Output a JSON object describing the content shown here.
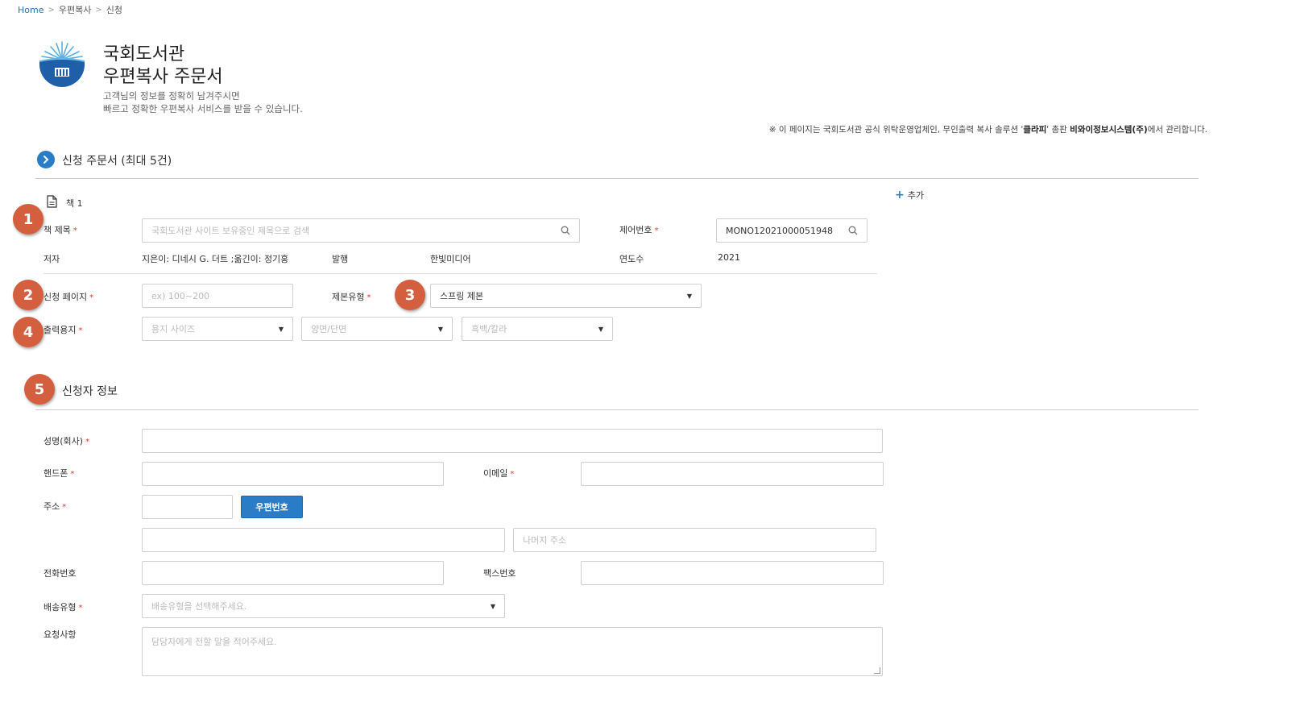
{
  "breadcrumb": {
    "home": "Home",
    "level1": "우편복사",
    "level2": "신청",
    "sep": ">"
  },
  "header": {
    "library_name": "국회도서관",
    "form_title": "우편복사 주문서",
    "desc_line1": "고객님의 정보를 정확히 남겨주시면",
    "desc_line2": "빠르고 정확한 우편복사 서비스를 받을 수 있습니다.",
    "notice_pre": "※ 이 페이지는 국회도서관 공식 위탁운영업체인, 무인출력 복사 솔루션 '",
    "notice_brand": "클라피",
    "notice_mid": "' 총판 ",
    "notice_company": "비와이정보시스템(주)",
    "notice_post": "에서 관리합니다."
  },
  "order_section": {
    "title": "신청 주문서 (최대 5건)",
    "add_label": "추가",
    "add_plus": "+",
    "book": {
      "label": "책 1",
      "title_label": "책 제목",
      "title_placeholder": "국회도서관 사이트 보유중인 제목으로 검색",
      "control_label": "제어번호",
      "control_value": "MONO12021000051948",
      "author_label": "저자",
      "author_value": "지은이: 디네시 G. 더트 ;옮긴이: 정기홍",
      "publisher_label": "발행",
      "publisher_value": "한빛미디어",
      "year_label": "연도수",
      "year_value": "2021",
      "pages_label": "신청 페이지",
      "pages_placeholder": "ex) 100~200",
      "binding_label": "제본유형",
      "binding_value": "스프링 제본",
      "paper_label": "출력용지",
      "paper_size_placeholder": "용지 사이즈",
      "sides_placeholder": "양면/단면",
      "color_placeholder": "흑백/칼라"
    }
  },
  "applicant_section": {
    "title": "신청자 정보",
    "name_label": "성명(회사)",
    "phone_label": "핸드폰",
    "email_label": "이메일",
    "address_label": "주소",
    "postcode_button": "우편번호",
    "address_rest_placeholder": "나머지 주소",
    "tel_label": "전화번호",
    "fax_label": "팩스번호",
    "delivery_label": "배송유형",
    "delivery_placeholder": "배송유형을 선택해주세요.",
    "request_label": "요청사항",
    "request_placeholder": "담당자에게 전할 말을 적어주세요."
  },
  "markers": [
    "1",
    "2",
    "3",
    "4",
    "5"
  ],
  "required_mark": "*",
  "colors": {
    "accent": "#2a7cc7",
    "marker": "#d35f3f",
    "required": "#e53935"
  }
}
